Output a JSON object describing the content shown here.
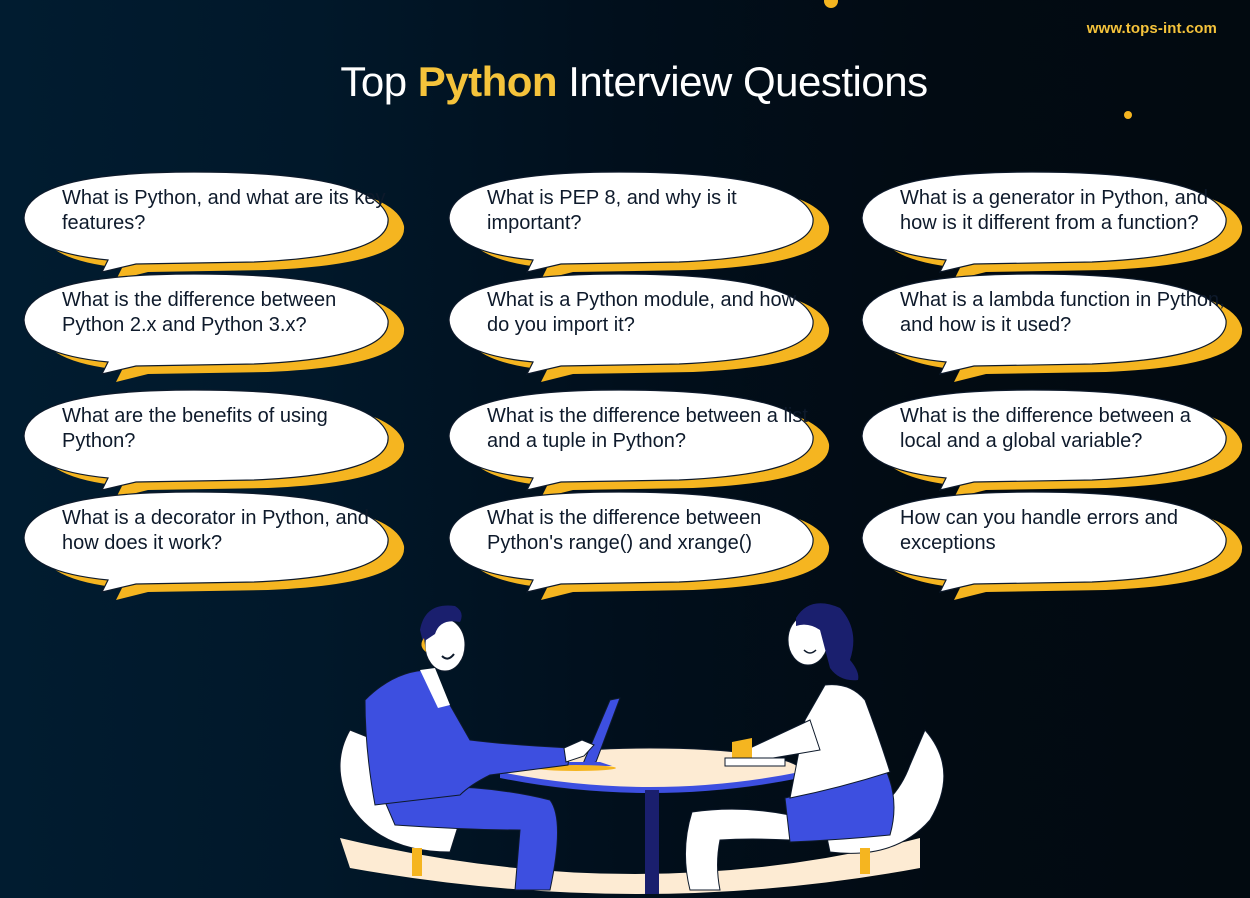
{
  "header": {
    "site_url": "www.tops-int.com",
    "title_prefix": "Top",
    "title_accent": "Python",
    "title_suffix": "Interview Questions"
  },
  "colors": {
    "background": "#011c30",
    "accent": "#f5c33b",
    "bubble_fill": "#ffffff",
    "bubble_shadow": "#f5b520",
    "text_dark": "#0e1a2b",
    "suit_blue": "#3d4fe0",
    "dark_navy": "#1a1f6e",
    "table_cream": "#fdebd3"
  },
  "questions": {
    "col1": [
      "What is Python, and what are its key features?",
      "What is the difference between Python 2.x and Python 3.x?",
      "What are the benefits of using Python?",
      "What is a decorator in Python, and how does it work?"
    ],
    "col2": [
      "What is PEP 8, and why is it important?",
      "What is a Python module, and how do you import it?",
      "What is the difference between a list and a tuple in Python?",
      "What is the difference between Python's range() and xrange()"
    ],
    "col3": [
      "What is a generator in Python, and how is it different from a function?",
      "What is a lambda function in Python, and how is it used?",
      "What is the difference between a local and a global variable?",
      "How can you handle errors and exceptions"
    ]
  },
  "illustration": {
    "description": "Man in blue suit with laptop and woman with notebook sitting at a round table for an interview"
  }
}
